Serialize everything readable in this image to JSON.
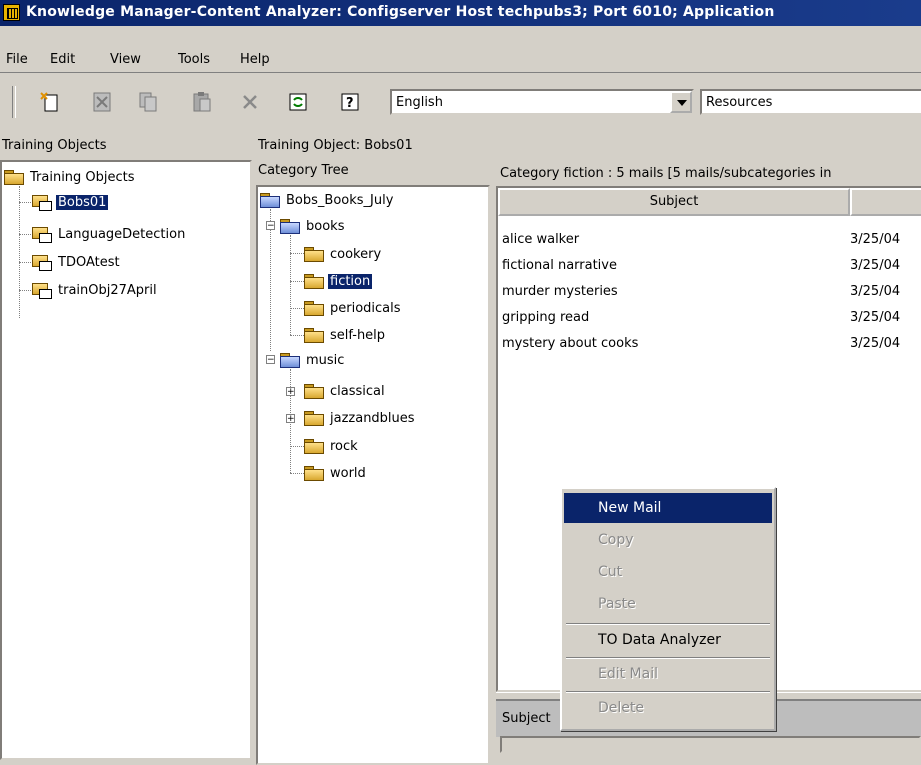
{
  "window": {
    "title": "Knowledge Manager-Content Analyzer: Configserver Host techpubs3; Port 6010; Application"
  },
  "menubar": {
    "items": [
      "File",
      "Edit",
      "View",
      "Tools",
      "Help"
    ]
  },
  "toolbar": {
    "language": "English",
    "resource": "Resources"
  },
  "left_panel": {
    "header": "Training Objects",
    "root": "Training Objects",
    "items": [
      "Bobs01",
      "LanguageDetection",
      "TDOAtest",
      "trainObj27April"
    ]
  },
  "middle_panel": {
    "header": "Training Object: Bobs01",
    "tree_header": "Category Tree",
    "root": "Bobs_Books_July",
    "books": {
      "label": "books",
      "children": [
        "cookery",
        "fiction",
        "periodicals",
        "self-help"
      ]
    },
    "music": {
      "label": "music",
      "children": [
        "classical",
        "jazzandblues",
        "rock",
        "world"
      ]
    }
  },
  "right_panel": {
    "header": "Category  fiction :   5 mails  [5 mails/subcategories in",
    "columns": [
      "Subject"
    ],
    "rows": [
      {
        "subject": "alice walker",
        "date": "3/25/04"
      },
      {
        "subject": "fictional narrative",
        "date": "3/25/04"
      },
      {
        "subject": "murder mysteries",
        "date": "3/25/04"
      },
      {
        "subject": "gripping read",
        "date": "3/25/04"
      },
      {
        "subject": "mystery about cooks",
        "date": "3/25/04"
      }
    ],
    "subject_label": "Subject"
  },
  "context_menu": {
    "items": [
      "New Mail",
      "Copy",
      "Cut",
      "Paste",
      "TO Data Analyzer",
      "Edit Mail",
      "Delete"
    ]
  },
  "colors": {
    "titlebar": "#0a246a",
    "selection": "#0a246a",
    "chrome": "#d4d0c8"
  }
}
